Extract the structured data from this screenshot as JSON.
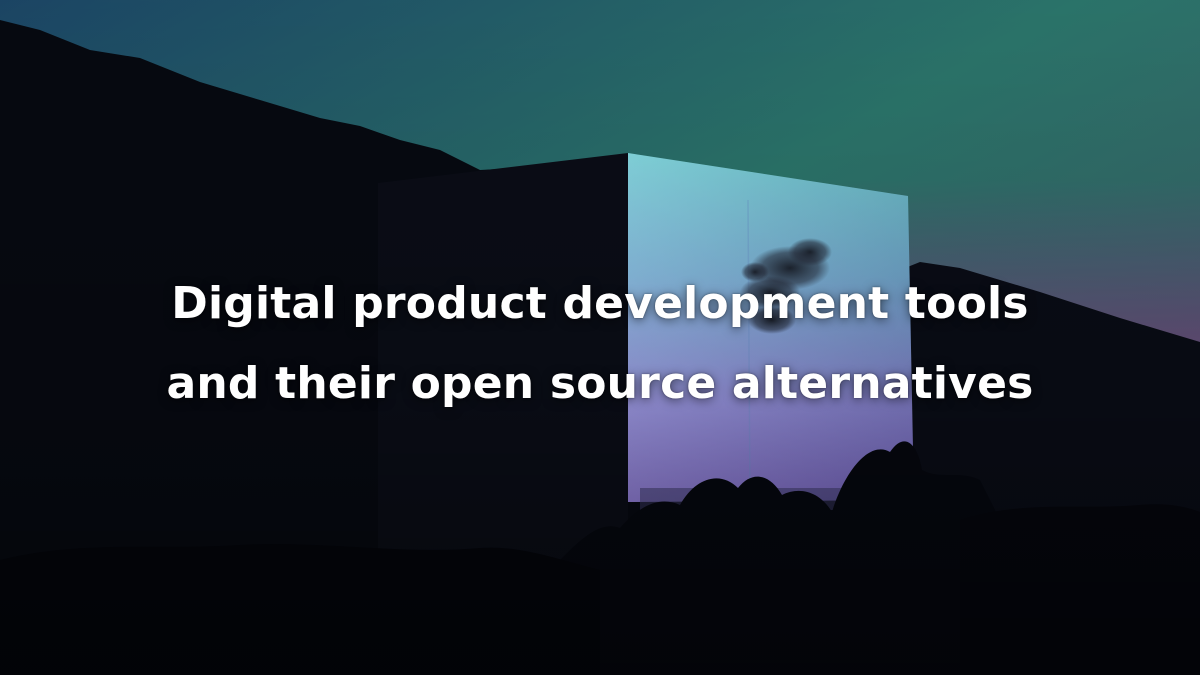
{
  "title": {
    "line1": "Digital product development tools",
    "line2": "and their open source alternatives"
  },
  "colors": {
    "sky_top": "#1e4d68",
    "sky_mid": "#2f8170",
    "sky_horizon": "#3e5f6e",
    "sky_dusk": "#6a4d7e",
    "cube_light_top": "#7ee2ee",
    "cube_light_mid": "#8fb4f2",
    "cube_light_bottom": "#a487ec",
    "silhouette": "#06080f",
    "text": "#ffffff"
  }
}
